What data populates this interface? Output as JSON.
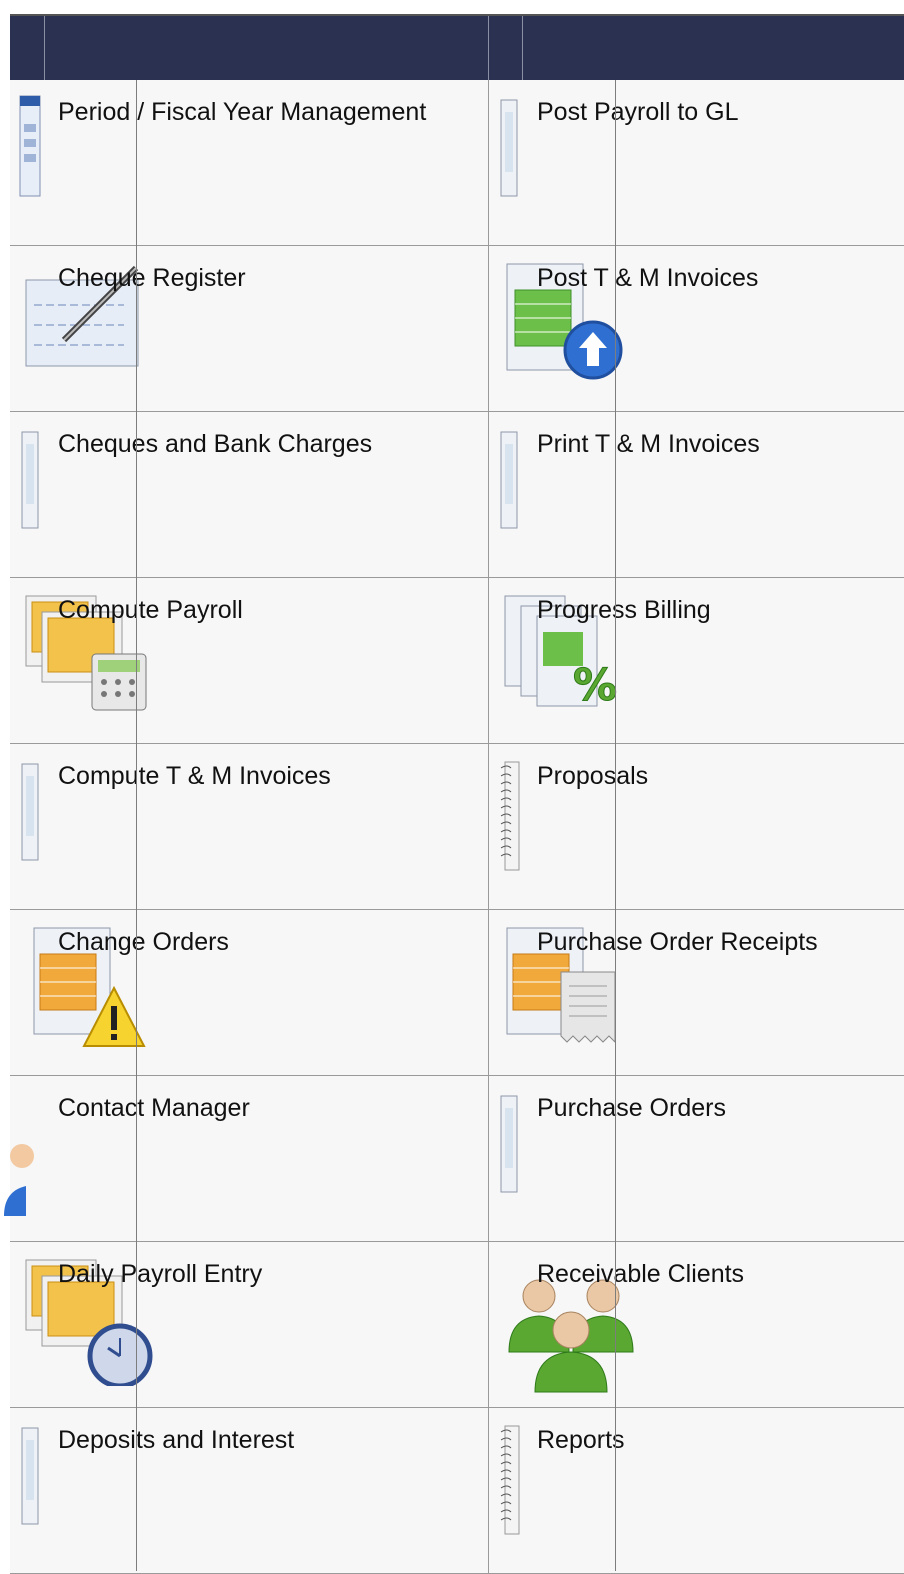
{
  "table": {
    "rows": [
      {
        "left": "Period / Fiscal Year Management",
        "right": "Post Payroll to GL",
        "left_icon": "calendar-icon",
        "right_icon": "document-icon"
      },
      {
        "left": "Cheque Register",
        "right": "Post T & M Invoices",
        "left_icon": "register-pen-icon",
        "right_icon": "invoice-upload-icon"
      },
      {
        "left": "Cheques and Bank Charges",
        "right": "Print T & M Invoices",
        "left_icon": "document-icon",
        "right_icon": "document-icon"
      },
      {
        "left": "Compute Payroll",
        "right": "Progress Billing",
        "left_icon": "payroll-calculator-icon",
        "right_icon": "billing-percent-icon"
      },
      {
        "left": "Compute T & M Invoices",
        "right": "Proposals",
        "left_icon": "document-icon",
        "right_icon": "spiral-notebook-icon"
      },
      {
        "left": "Change Orders",
        "right": "Purchase Order Receipts",
        "left_icon": "document-warning-icon",
        "right_icon": "document-receipt-icon"
      },
      {
        "left": "Contact Manager",
        "right": "Purchase Orders",
        "left_icon": "contact-person-icon",
        "right_icon": "document-icon"
      },
      {
        "left": "Daily Payroll Entry",
        "right": "Receivable Clients",
        "left_icon": "payroll-clock-icon",
        "right_icon": "clients-group-icon"
      },
      {
        "left": "Deposits and Interest",
        "right": "Reports",
        "left_icon": "document-icon",
        "right_icon": "spiral-notebook-icon"
      }
    ]
  }
}
